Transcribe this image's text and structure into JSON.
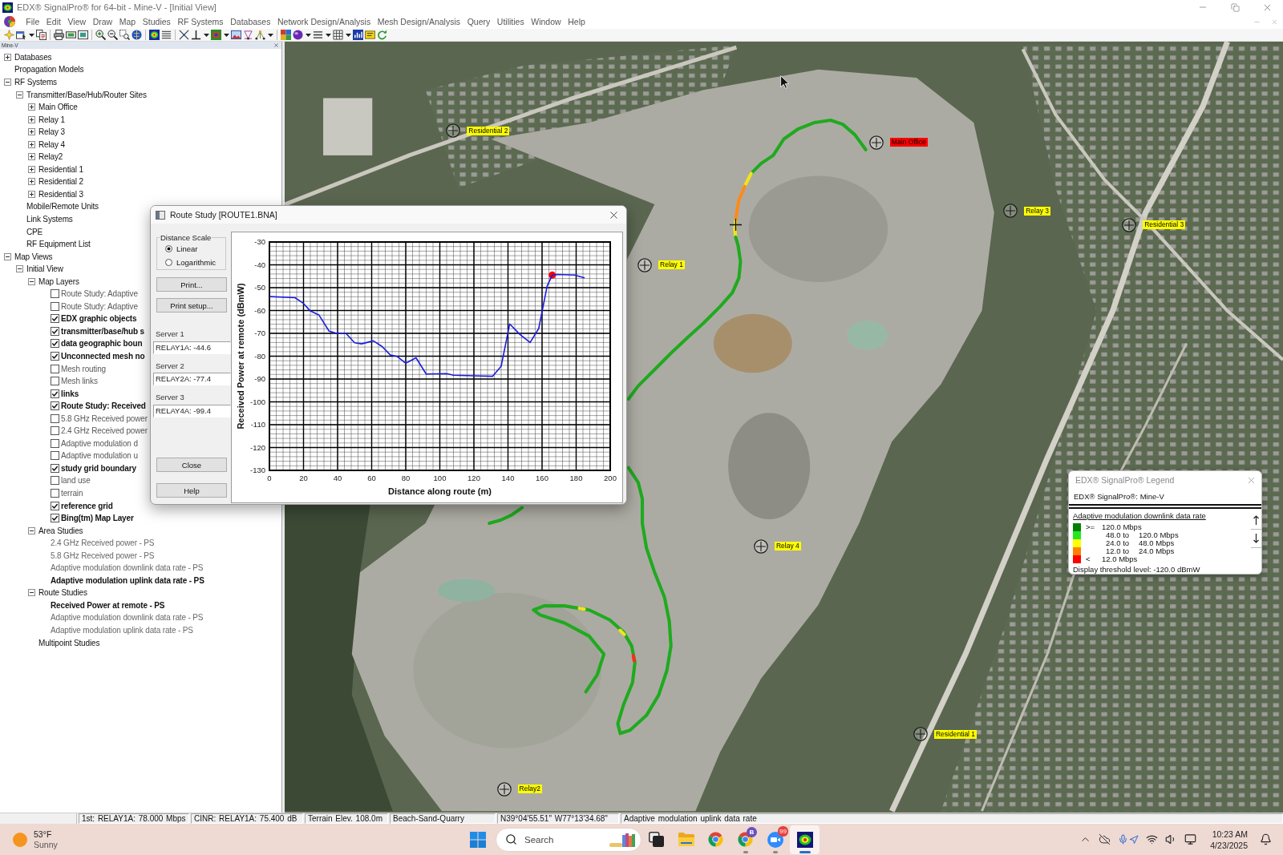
{
  "window": {
    "title": "EDX® SignalPro® for 64-bit - Mine-V - [Initial View]"
  },
  "menu": [
    "File",
    "Edit",
    "View",
    "Draw",
    "Map",
    "Studies",
    "RF Systems",
    "Databases",
    "Network Design/Analysis",
    "Mesh Design/Analysis",
    "Query",
    "Utilities",
    "Window",
    "Help"
  ],
  "project_panel": {
    "title": "Mine-V",
    "tree": [
      {
        "label": "Databases",
        "expanded": false
      },
      {
        "label": "Propagation Models"
      },
      {
        "label": "RF Systems",
        "expanded": true,
        "children": [
          {
            "label": "Transmitter/Base/Hub/Router Sites",
            "expanded": true,
            "children": [
              {
                "label": "Main Office",
                "expanded": false
              },
              {
                "label": "Relay 1",
                "expanded": false
              },
              {
                "label": "Relay 3",
                "expanded": false
              },
              {
                "label": "Relay 4",
                "expanded": false
              },
              {
                "label": "Relay2",
                "expanded": false
              },
              {
                "label": "Residential 1",
                "expanded": false
              },
              {
                "label": "Residential 2",
                "expanded": false
              },
              {
                "label": "Residential 3",
                "expanded": false
              }
            ]
          },
          {
            "label": "Mobile/Remote Units"
          },
          {
            "label": "Link Systems"
          },
          {
            "label": "CPE"
          },
          {
            "label": "RF Equipment List"
          }
        ]
      },
      {
        "label": "Map Views",
        "expanded": true,
        "children": [
          {
            "label": "Initial View",
            "expanded": true,
            "children": [
              {
                "label": "Map Layers",
                "expanded": true,
                "children": [
                  {
                    "label": "Route Study: Adaptive",
                    "checked": false
                  },
                  {
                    "label": "Route Study: Adaptive",
                    "checked": false
                  },
                  {
                    "label": "EDX graphic objects",
                    "checked": true
                  },
                  {
                    "label": "transmitter/base/hub s",
                    "checked": true
                  },
                  {
                    "label": "data geographic boun",
                    "checked": true
                  },
                  {
                    "label": "Unconnected mesh no",
                    "checked": true
                  },
                  {
                    "label": "Mesh routing",
                    "checked": false
                  },
                  {
                    "label": "Mesh links",
                    "checked": false
                  },
                  {
                    "label": "links",
                    "checked": true
                  },
                  {
                    "label": "Route Study: Received",
                    "checked": true
                  },
                  {
                    "label": "5.8 GHz Received power",
                    "checked": false
                  },
                  {
                    "label": "2.4 GHz Received power",
                    "checked": false
                  },
                  {
                    "label": "Adaptive modulation d",
                    "checked": false
                  },
                  {
                    "label": "Adaptive modulation u",
                    "checked": false
                  },
                  {
                    "label": "study grid boundary",
                    "checked": true
                  },
                  {
                    "label": "land use",
                    "checked": false
                  },
                  {
                    "label": "terrain",
                    "checked": false
                  },
                  {
                    "label": "reference grid",
                    "checked": true
                  },
                  {
                    "label": "Bing(tm) Map Layer",
                    "checked": true
                  }
                ]
              },
              {
                "label": "Area Studies",
                "expanded": true,
                "children": [
                  {
                    "label": "2.4 GHz Received power - PS",
                    "active": false
                  },
                  {
                    "label": "5.8 GHz Received power - PS",
                    "active": false
                  },
                  {
                    "label": "Adaptive modulation downlink data rate - PS",
                    "active": false
                  },
                  {
                    "label": "Adaptive modulation uplink data rate - PS",
                    "active": true
                  }
                ]
              },
              {
                "label": "Route Studies",
                "expanded": true,
                "children": [
                  {
                    "label": "Received Power at remote - PS",
                    "active": true
                  },
                  {
                    "label": "Adaptive modulation downlink data rate - PS",
                    "active": false
                  },
                  {
                    "label": "Adaptive modulation uplink data rate - PS",
                    "active": false
                  }
                ]
              },
              {
                "label": "Multipoint Studies"
              }
            ]
          }
        ]
      }
    ]
  },
  "route_study": {
    "title": "Route Study [ROUTE1.BNA]",
    "distance_scale": {
      "label": "Distance Scale",
      "options": [
        {
          "label": "Linear",
          "selected": true
        },
        {
          "label": "Logarithmic",
          "selected": false
        }
      ]
    },
    "print_buttons": [
      "Print...",
      "Print setup..."
    ],
    "servers": [
      {
        "label": "Server 1",
        "value": "RELAY1A: -44.6"
      },
      {
        "label": "Server 2",
        "value": "RELAY2A: -77.4"
      },
      {
        "label": "Server 3",
        "value": "RELAY4A: -99.4"
      }
    ],
    "bottom_buttons": [
      "Close",
      "Help"
    ],
    "chart_data": {
      "type": "line",
      "xlabel": "Distance along route (m)",
      "ylabel": "Received Power at remote (dBmW)",
      "x": [
        0,
        15,
        20,
        24,
        29,
        35,
        40,
        45,
        50,
        54,
        61,
        66,
        71,
        75,
        80,
        86,
        92,
        104,
        108,
        120,
        131,
        136,
        141,
        147,
        153,
        158,
        163,
        166,
        169,
        179,
        185
      ],
      "series": [
        {
          "color": "#1c1ce0",
          "values": [
            -53.9,
            -54.4,
            -56.9,
            -60.2,
            -61.9,
            -69,
            -70.1,
            -70.1,
            -74.1,
            -74.6,
            -73.3,
            -75.7,
            -79.5,
            -80.1,
            -83.1,
            -80.7,
            -87.8,
            -87.6,
            -88.3,
            -88.6,
            -88.8,
            -84.4,
            -65.9,
            -70.5,
            -74,
            -67.9,
            -49.2,
            -44.5,
            -44.2,
            -44.5,
            -45.7
          ]
        },
        {
          "color": "#ff0000",
          "marker": "circle",
          "values": [
            null,
            null,
            null,
            null,
            null,
            null,
            null,
            null,
            null,
            null,
            null,
            null,
            null,
            null,
            null,
            null,
            null,
            null,
            null,
            null,
            null,
            null,
            null,
            null,
            null,
            null,
            null,
            -44.5,
            null,
            null,
            null
          ]
        }
      ],
      "xlim": [
        0,
        200
      ],
      "ylim": [
        -130,
        -30
      ],
      "xticks": [
        0,
        20,
        40,
        60,
        80,
        100,
        120,
        140,
        160,
        180,
        200
      ],
      "yticks": [
        -30,
        -40,
        -50,
        -60,
        -70,
        -80,
        -90,
        -100,
        -110,
        -120,
        -130
      ],
      "grid": true
    }
  },
  "map": {
    "sites": [
      {
        "label": "Residential 2",
        "color": "#ffff00"
      },
      {
        "label": "Main Office",
        "color": "#ff0000"
      },
      {
        "label": "Relay 3",
        "color": "#ffff00"
      },
      {
        "label": "Residential 3",
        "color": "#ffff00"
      },
      {
        "label": "Relay 1",
        "color": "#ffff00"
      },
      {
        "label": "Relay 4",
        "color": "#ffff00"
      },
      {
        "label": "Residential 1",
        "color": "#ffff00"
      },
      {
        "label": "Relay2",
        "color": "#ffff00"
      }
    ],
    "legend": {
      "title": "EDX® SignalPro® Legend",
      "project": "EDX® SignalPro®: Mine-V",
      "heading": "Adaptive modulation downlink data rate",
      "rows": [
        {
          "kind": "bound",
          "color": "#008000",
          "operator": ">=",
          "value": "120.0 Mbps"
        },
        {
          "kind": "range",
          "color": "#22e822",
          "from": "48.0 to",
          "to": "120.0 Mbps"
        },
        {
          "kind": "range",
          "color": "#ffff00",
          "from": "24.0 to",
          "to": "48.0 Mbps"
        },
        {
          "kind": "range",
          "color": "#ff8000",
          "from": "12.0 to",
          "to": "24.0 Mbps"
        },
        {
          "kind": "bound",
          "color": "#ff0000",
          "operator": "<",
          "value": "12.0 Mbps"
        }
      ],
      "threshold": "Display threshold level: -120.0 dBmW"
    }
  },
  "status_bar": [
    "1st: RELAY1A: 78.000 Mbps",
    "CINR: RELAY1A: 75.400 dB",
    "Terrain Elev. 108.0m",
    "Beach-Sand-Quarry",
    "N39°04'55.51\" W77°13'34.68\"",
    "Adaptive modulation uplink data rate"
  ],
  "taskbar": {
    "weather": {
      "temperature": "53°F",
      "condition": "Sunny"
    },
    "search": {
      "placeholder": "Search"
    },
    "apps": [
      {
        "kind": "task_view",
        "running": false,
        "selected": false
      },
      {
        "kind": "folder",
        "running": false,
        "selected": false
      },
      {
        "kind": "browser",
        "running": false,
        "selected": false
      },
      {
        "kind": "browser",
        "badge": "B",
        "running": true,
        "selected": false
      },
      {
        "kind": "video",
        "badge": "99",
        "running": true,
        "selected": false
      },
      {
        "kind": "coverage_app",
        "running": true,
        "selected": true
      }
    ],
    "clock": {
      "time": "10:23 AM",
      "date": "4/23/2025"
    }
  }
}
